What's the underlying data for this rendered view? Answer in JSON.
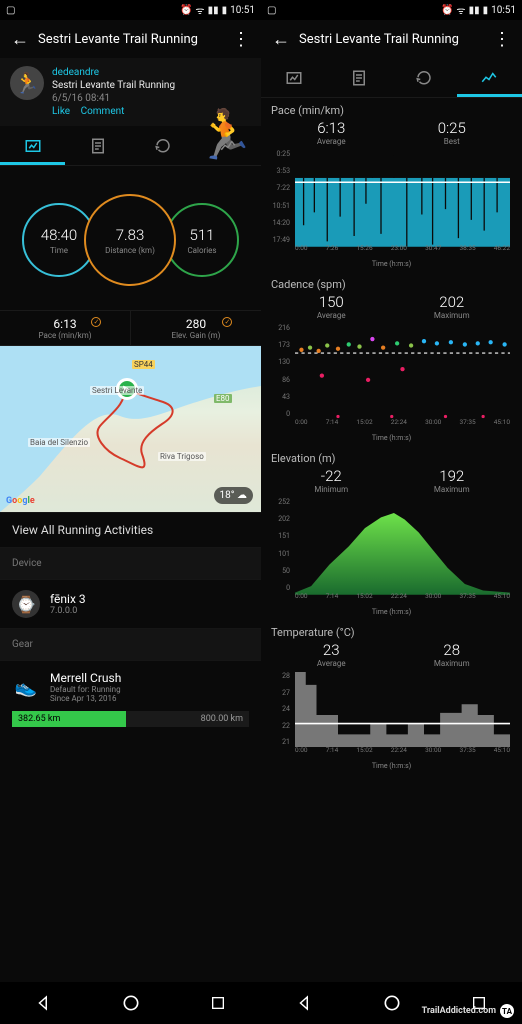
{
  "status": {
    "time": "10:51"
  },
  "header": {
    "title": "Sestri Levante Trail Running"
  },
  "left": {
    "post": {
      "user": "dedeandre",
      "title": "Sestri Levante Trail Running",
      "date": "6/5/16 08:41",
      "like": "Like",
      "comment": "Comment"
    },
    "rings": {
      "time": {
        "value": "48:40",
        "label": "Time"
      },
      "distance": {
        "value": "7.83",
        "label": "Distance (km)"
      },
      "calories": {
        "value": "511",
        "label": "Calories"
      }
    },
    "pace_row": {
      "value": "6:13",
      "label": "Pace (min/km)"
    },
    "elev_row": {
      "value": "280",
      "label": "Elev. Gain (m)"
    },
    "map": {
      "weather": "18°",
      "towns": [
        "Sestri Levante",
        "Baia del Silenzio",
        "Riva Trigoso",
        "SP44",
        "E80"
      ]
    },
    "view_all": "View All Running Activities",
    "device_label": "Device",
    "device": {
      "name": "fēnix 3",
      "ver": "7.0.0.0"
    },
    "gear_label": "Gear",
    "gear": {
      "name": "Merrell Crush",
      "default": "Default for: Running",
      "since": "Since Apr 13, 2016",
      "current": "382.65 km",
      "total": "800.00 km",
      "pct": 48
    }
  },
  "right": {
    "pace": {
      "title": "Pace (min/km)",
      "avg": {
        "value": "6:13",
        "label": "Average"
      },
      "best": {
        "value": "0:25",
        "label": "Best"
      },
      "yticks": [
        "0:25",
        "3:53",
        "7:22",
        "10:51",
        "14:20",
        "17:49"
      ],
      "xticks": [
        "0:00",
        "7:26",
        "15:26",
        "23:00",
        "30:47",
        "38:35",
        "46:22"
      ],
      "xlabel": "Time (h:m:s)"
    },
    "cadence": {
      "title": "Cadence (spm)",
      "avg": {
        "value": "150",
        "label": "Average"
      },
      "max": {
        "value": "202",
        "label": "Maximum"
      },
      "yticks": [
        "216",
        "173",
        "130",
        "86",
        "43",
        "0"
      ],
      "xticks": [
        "0:00",
        "7:14",
        "15:02",
        "22:24",
        "30:00",
        "37:35",
        "45:10"
      ],
      "xlabel": "Time (h:m:s)"
    },
    "elevation": {
      "title": "Elevation (m)",
      "min": {
        "value": "-22",
        "label": "Minimum"
      },
      "max": {
        "value": "192",
        "label": "Maximum"
      },
      "yticks": [
        "252",
        "202",
        "151",
        "101",
        "50",
        "0"
      ],
      "xticks": [
        "0:00",
        "7:14",
        "15:02",
        "22:24",
        "30:00",
        "37:35",
        "45:10"
      ],
      "xlabel": "Time (h:m:s)"
    },
    "temperature": {
      "title": "Temperature (°C)",
      "avg": {
        "value": "23",
        "label": "Average"
      },
      "max": {
        "value": "28",
        "label": "Maximum"
      },
      "yticks": [
        "28",
        "27",
        "24",
        "22",
        "21"
      ],
      "xticks": [
        "0:00",
        "7:14",
        "15:02",
        "22:24",
        "30:00",
        "37:35",
        "45:10"
      ],
      "xlabel": "Time (h:m:s)"
    }
  },
  "brand": "TrailAddicted.com",
  "chart_data": [
    {
      "type": "area",
      "name": "pace",
      "x": [
        "0:00",
        "7:26",
        "15:26",
        "23:00",
        "30:47",
        "38:35",
        "46:22"
      ],
      "ylim_pace_min_km": [
        0.42,
        17.82
      ],
      "avg_line": 6.22,
      "note": "dense per-second pace bars; min 0:25, avg 6:13"
    },
    {
      "type": "scatter",
      "name": "cadence_spm",
      "x": [
        "0:00",
        "7:14",
        "15:02",
        "22:24",
        "30:00",
        "37:35",
        "45:10"
      ],
      "ylim": [
        0,
        216
      ],
      "avg": 150,
      "max": 202,
      "main_band_range": [
        130,
        173
      ]
    },
    {
      "type": "area",
      "name": "elevation_m",
      "x_minutes": [
        0,
        5,
        10,
        14,
        18,
        22,
        26,
        30,
        34,
        38,
        42,
        46
      ],
      "values": [
        0,
        20,
        75,
        120,
        155,
        188,
        170,
        120,
        60,
        25,
        12,
        5
      ],
      "ylim": [
        0,
        252
      ],
      "min": -22,
      "max": 192
    },
    {
      "type": "area",
      "name": "temperature_c",
      "x_minutes": [
        0,
        3,
        6,
        10,
        14,
        18,
        22,
        26,
        30,
        34,
        38,
        42,
        46
      ],
      "values": [
        28,
        27,
        24,
        22,
        22,
        23,
        22,
        23,
        22,
        24,
        25,
        24,
        22
      ],
      "ylim": [
        21,
        28
      ],
      "avg": 23,
      "max": 28
    }
  ]
}
